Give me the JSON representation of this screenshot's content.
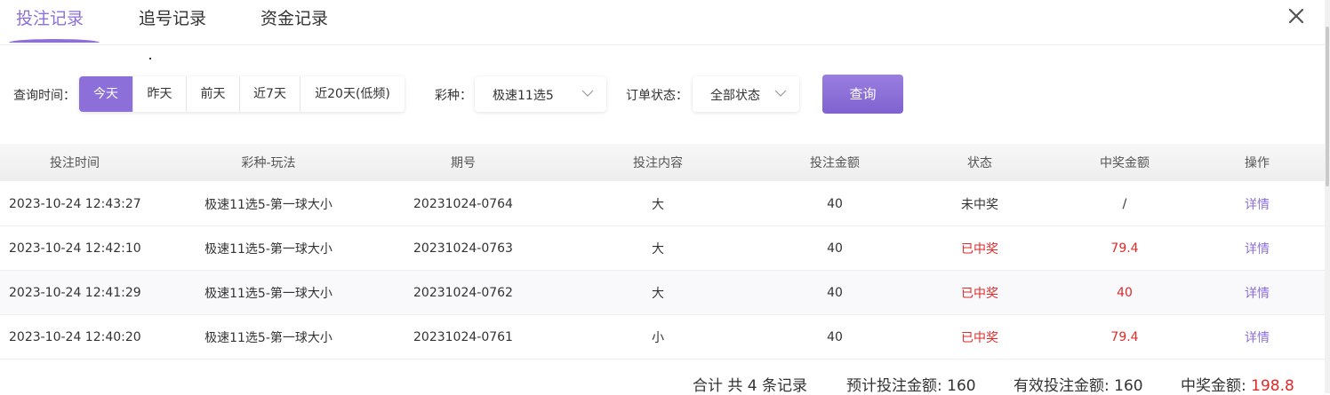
{
  "tabs": [
    {
      "label": "投注记录",
      "active": true
    },
    {
      "label": "追号记录",
      "active": false
    },
    {
      "label": "资金记录",
      "active": false
    }
  ],
  "filters": {
    "time_label": "查询时间：",
    "time_options": [
      "今天",
      "昨天",
      "前天",
      "近7天",
      "近20天(低频)"
    ],
    "time_selected": "今天",
    "lottery_label": "彩种：",
    "lottery_value": "极速11选5",
    "status_label": "订单状态：",
    "status_value": "全部状态",
    "query_label": "查询"
  },
  "table": {
    "headers": [
      "投注时间",
      "彩种-玩法",
      "期号",
      "投注内容",
      "投注金额",
      "状态",
      "中奖金额",
      "操作"
    ],
    "rows": [
      [
        "2023-10-24 12:43:27",
        "极速11选5-第一球大小",
        "20231024-0764",
        "大",
        "40",
        "未中奖",
        "/",
        "详情"
      ],
      [
        "2023-10-24 12:42:10",
        "极速11选5-第一球大小",
        "20231024-0763",
        "大",
        "40",
        "已中奖",
        "79.4",
        "详情"
      ],
      [
        "2023-10-24 12:41:29",
        "极速11选5-第一球大小",
        "20231024-0762",
        "大",
        "40",
        "已中奖",
        "40",
        "详情"
      ],
      [
        "2023-10-24 12:40:20",
        "极速11选5-第一球大小",
        "20231024-0761",
        "小",
        "40",
        "已中奖",
        "79.4",
        "详情"
      ]
    ]
  },
  "summary": {
    "count_text": "合计 共 4 条记录",
    "expected_label": "预计投注金额: ",
    "expected_value": "160",
    "effective_label": "有效投注金额: ",
    "effective_value": "160",
    "win_label": "中奖金额: ",
    "win_value": "198.8"
  },
  "colors": {
    "accent": "#8c6fd8",
    "won": "#e02a2a"
  },
  "icons": {
    "close": "close-icon",
    "dropdown": "chevron-down-icon"
  }
}
